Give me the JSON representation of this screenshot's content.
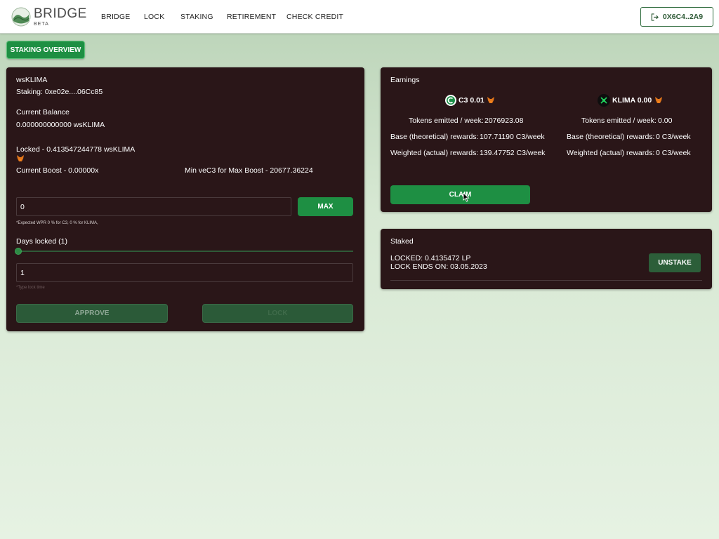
{
  "header": {
    "brand": "BRIDGE",
    "brand_sub": "BETA",
    "nav": [
      "BRIDGE",
      "LOCK",
      "STAKING",
      "RETIREMENT",
      "CHECK CREDIT"
    ],
    "wallet_label": "0X6C4..2A9"
  },
  "overview_button": "STAKING OVERVIEW",
  "left_panel": {
    "token": "wsKLIMA",
    "staking_address": "Staking: 0xe02e....06Cc85",
    "current_balance_label": "Current Balance",
    "current_balance_value": "0.000000000000 wsKLIMA",
    "locked": "Locked - 0.413547244778 wsKLIMA",
    "current_boost": "Current Boost - 0.00000x",
    "min_vec3": "Min veC3 for Max Boost - 20677.36224",
    "amount_value": "0",
    "max_label": "MAX",
    "expected_wpr": "*Expected WPR 0 % for C3, 0 % for KLIMA,",
    "days_locked_label": "Days locked (1)",
    "days_value": "1",
    "type_lock_hint": "*Type lock time",
    "approve_label": "APPROVE",
    "lock_label": "LOCK",
    "days_slider_fraction": 0
  },
  "earnings": {
    "title": "Earnings",
    "c3": {
      "label": "C3 0.01",
      "tokens_emitted_label": "Tokens emitted / week:",
      "tokens_emitted_value": "2076923.08",
      "base_label": "Base (theoretical) rewards:",
      "base_value": "107.71190 C3/week",
      "weighted_label": "Weighted (actual) rewards:",
      "weighted_value": "139.47752 C3/week"
    },
    "klima": {
      "label": "KLIMA 0.00",
      "tokens_emitted_label": "Tokens emitted / week:",
      "tokens_emitted_value": "0.00",
      "base_label": "Base (theoretical) rewards:",
      "base_value": "0 C3/week",
      "weighted_label": "Weighted (actual) rewards:",
      "weighted_value": "0 C3/week"
    },
    "claim_label": "CLAIM"
  },
  "staked": {
    "title": "Staked",
    "locked": "LOCKED: 0.4135472 LP",
    "lock_ends": "LOCK ENDS ON: 03.05.2023",
    "unstake_label": "UNSTAKE"
  },
  "colors": {
    "accent_green": "#1e8f43",
    "panel_bg": "#2a1618",
    "dark_button": "#2b5a38"
  }
}
